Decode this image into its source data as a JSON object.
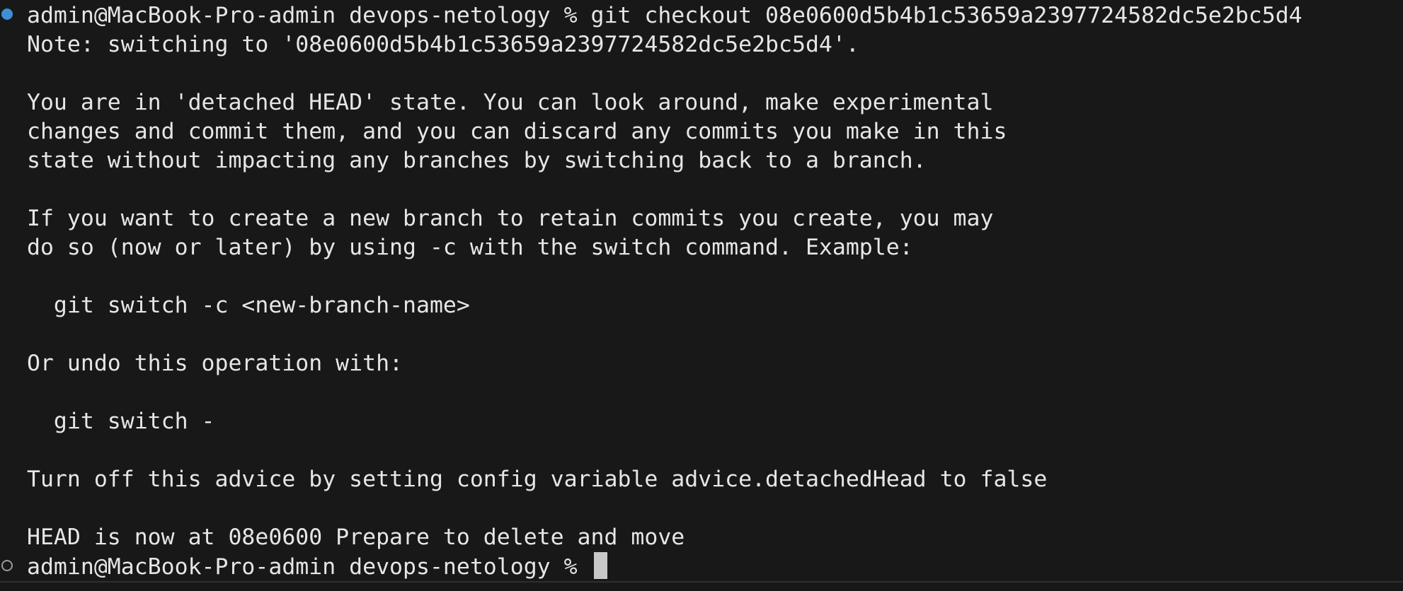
{
  "terminal": {
    "prompt_host": "admin@MacBook-Pro-admin devops-netology % ",
    "command": "git checkout 08e0600d5b4b1c53659a2397724582dc5e2bc5d4",
    "output": [
      "Note: switching to '08e0600d5b4b1c53659a2397724582dc5e2bc5d4'.",
      "",
      "You are in 'detached HEAD' state. You can look around, make experimental",
      "changes and commit them, and you can discard any commits you make in this",
      "state without impacting any branches by switching back to a branch.",
      "",
      "If you want to create a new branch to retain commits you create, you may",
      "do so (now or later) by using -c with the switch command. Example:",
      "",
      "  git switch -c <new-branch-name>",
      "",
      "Or undo this operation with:",
      "",
      "  git switch -",
      "",
      "Turn off this advice by setting config variable advice.detachedHead to false",
      "",
      "HEAD is now at 08e0600 Prepare to delete and move"
    ],
    "current_prompt": "admin@MacBook-Pro-admin devops-netology %",
    "colors": {
      "background": "#181818",
      "text": "#e6e6e6",
      "success_marker": "#3d8fd6",
      "empty_marker": "#9a9a9a",
      "cursor": "#c8c8c8"
    }
  }
}
